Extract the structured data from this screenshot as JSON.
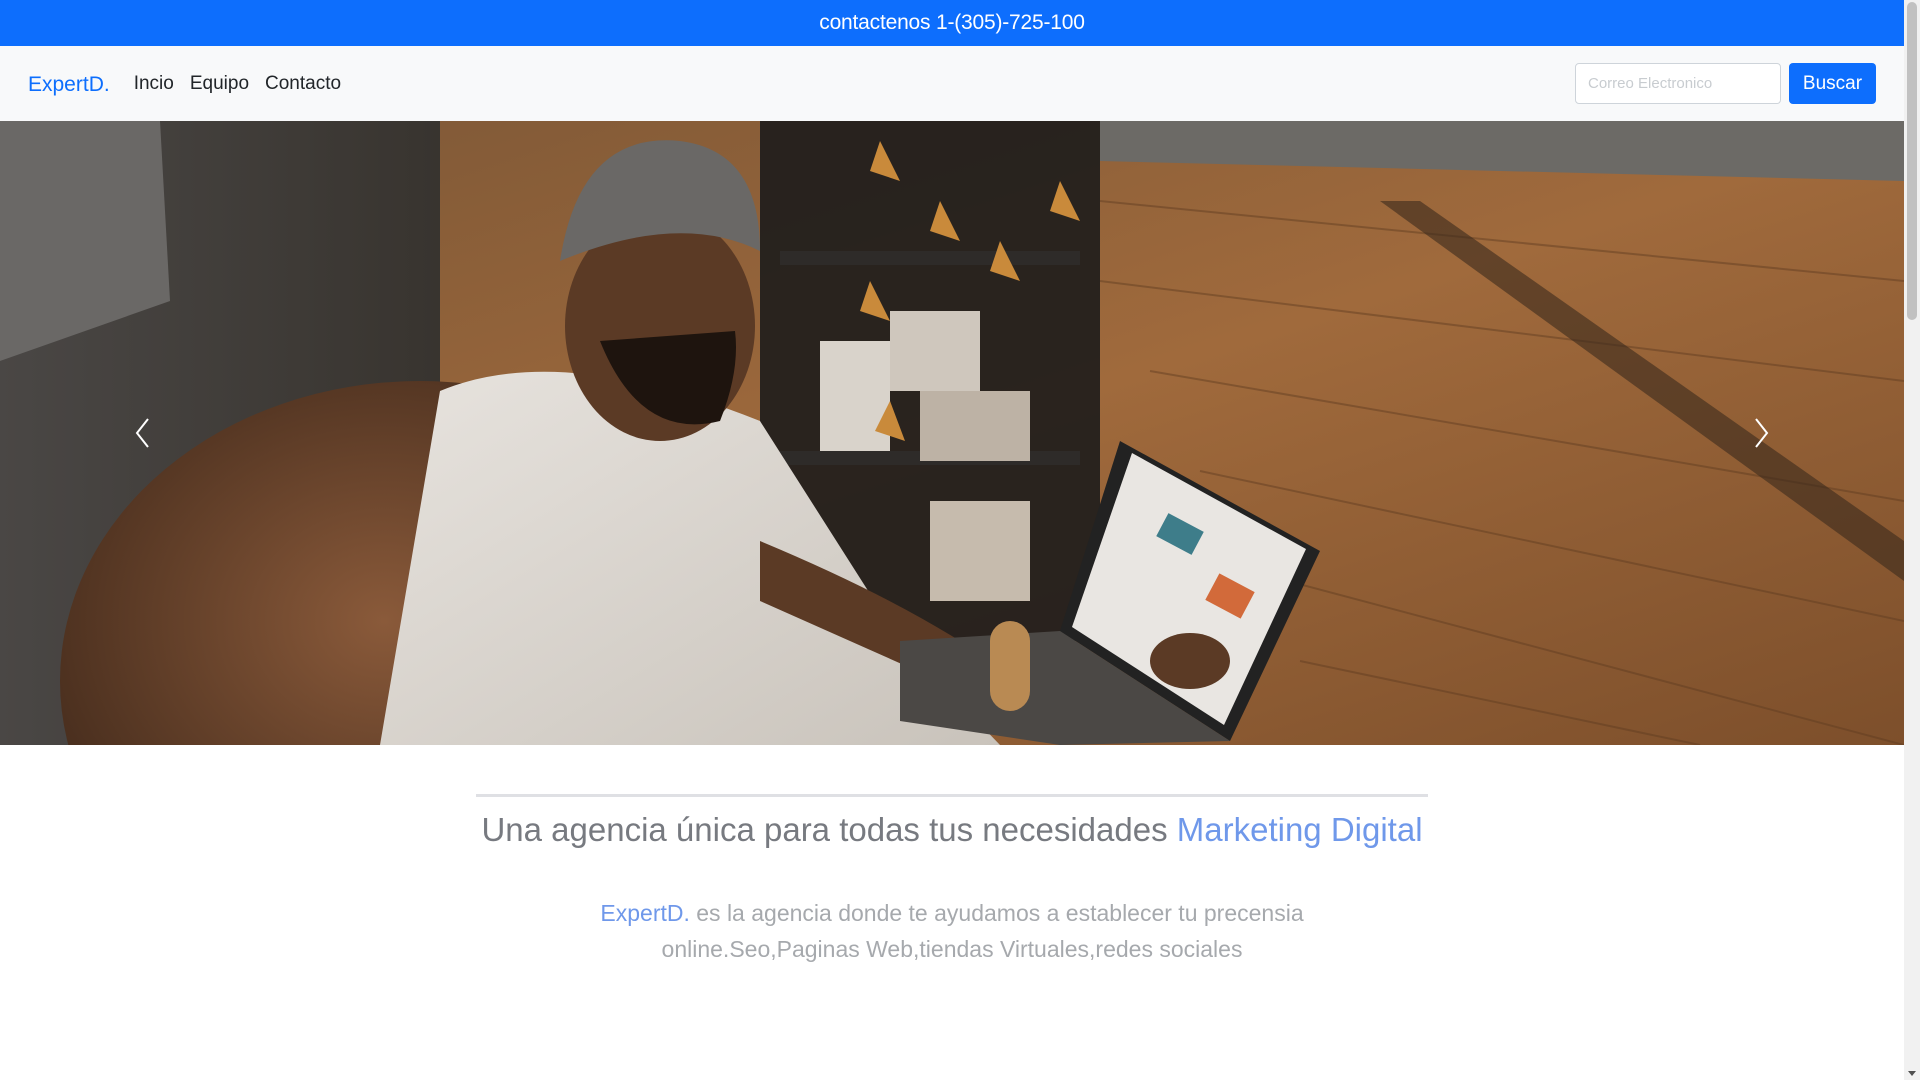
{
  "topbar": {
    "contact_text": "contactenos 1-(305)-725-100"
  },
  "navbar": {
    "brand": "ExpertD.",
    "links": [
      {
        "label": "Incio"
      },
      {
        "label": "Equipo"
      },
      {
        "label": "Contacto"
      }
    ],
    "search": {
      "placeholder": "Correo Electronico",
      "value": "",
      "button_label": "Buscar"
    }
  },
  "carousel": {
    "prev_icon": "chevron-left-icon",
    "next_icon": "chevron-right-icon"
  },
  "hero": {
    "headline_main": "Una agencia única para todas tus necesidades ",
    "headline_accent": "Marketing Digital",
    "intro_brand": "ExpertD.",
    "intro_text": " es la agencia donde te ayudamos a establecer tu precensia online.Seo,Paginas Web,tiendas Virtuales,redes sociales"
  },
  "colors": {
    "primary": "#0d6efd",
    "accent_text": "#6f98ea",
    "navbar_bg": "#f8f9fa"
  }
}
